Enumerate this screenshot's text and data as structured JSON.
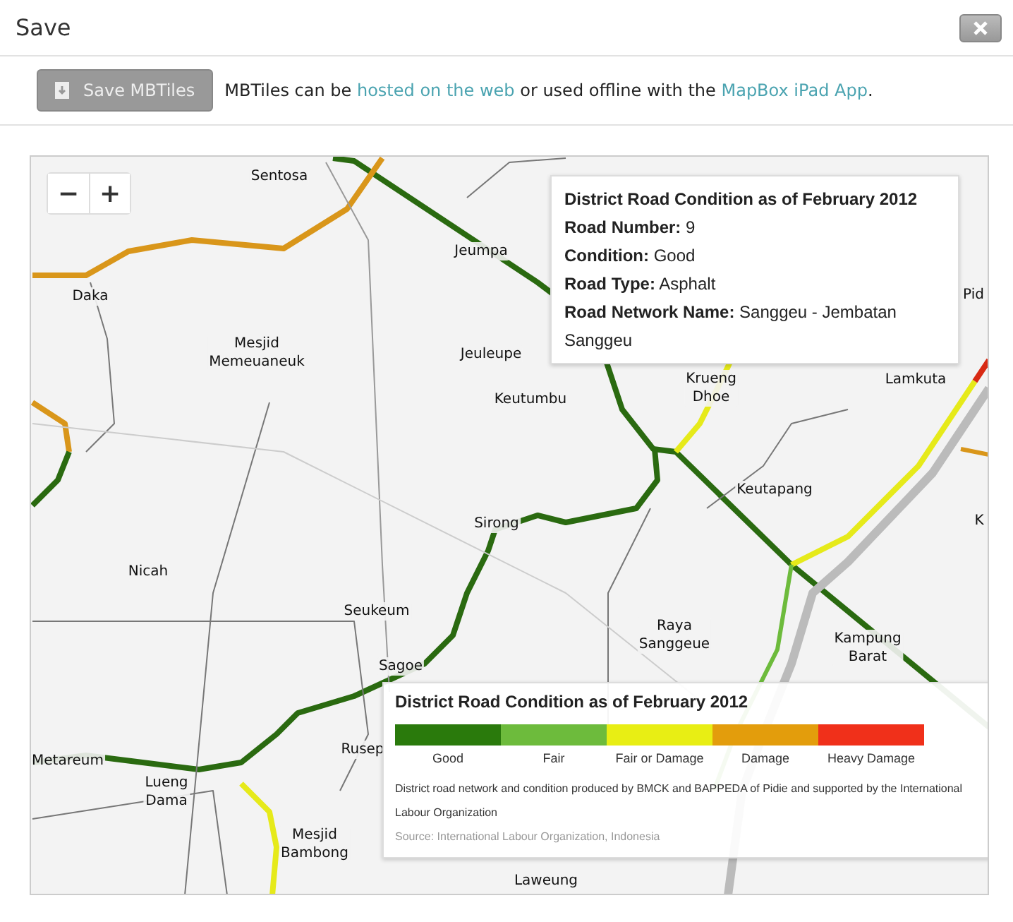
{
  "dialog": {
    "title": "Save"
  },
  "toolbar": {
    "button": "Save MBTiles",
    "description": [
      {
        "kind": "text",
        "text": "MBTiles can be "
      },
      {
        "kind": "link",
        "text": "hosted on the web"
      },
      {
        "kind": "text",
        "text": " or used offline with the "
      },
      {
        "kind": "link",
        "text": "MapBox iPad App"
      },
      {
        "kind": "text",
        "text": "."
      }
    ]
  },
  "map": {
    "zoom_out": "−",
    "zoom_in": "+",
    "places": [
      "Sentosa",
      "Daka",
      "Mesjid Memeuaneuk",
      "Jeumpa",
      "Jeuleupe",
      "Keutumbu",
      "Krueng Dhoe",
      "Lamkuta",
      "Keutapang",
      "Sirong",
      "Nicah",
      "Seukeum",
      "Raya Sanggeue",
      "Kampung Barat",
      "Sagoe",
      "Rusep",
      "Metareum",
      "Lueng Dama",
      "Mesjid Bambong",
      "Laweung",
      "Pid",
      "K"
    ],
    "tooltip": {
      "title": "District Road Condition as of February 2012",
      "fields": [
        {
          "label": "Road Number:",
          "value": "9"
        },
        {
          "label": "Condition:",
          "value": "Good"
        },
        {
          "label": "Road Type:",
          "value": "Asphalt"
        },
        {
          "label": "Road Network Name:",
          "value": "Sanggeu - Jembatan Sanggeu"
        }
      ]
    },
    "legend": {
      "title": "District Road Condition as of February 2012",
      "scale": [
        {
          "label": "Good",
          "color": "#2a7a0c"
        },
        {
          "label": "Fair",
          "color": "#6dbb3c"
        },
        {
          "label": "Fair or Damage",
          "color": "#e8ee14"
        },
        {
          "label": "Damage",
          "color": "#e39d0c"
        },
        {
          "label": "Heavy Damage",
          "color": "#f0301a"
        }
      ],
      "note": "District road network and condition produced by BMCK and BAPPEDA of Pidie and supported by the International Labour Organization",
      "source": "Source: International Labour Organization, Indonesia"
    }
  }
}
